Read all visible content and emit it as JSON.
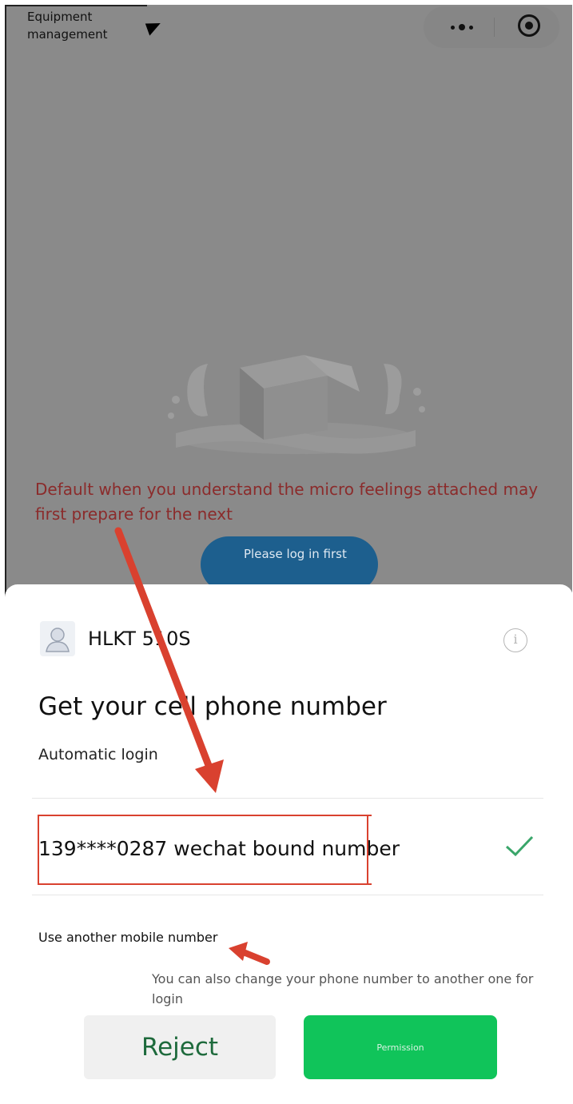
{
  "header": {
    "title": "Equipment management",
    "menu_icon": "more-dots-icon",
    "close_icon": "record-circle-icon"
  },
  "background": {
    "empty_state_icon": "open-box-icon",
    "annotation": "Default when you understand the micro feelings attached may first prepare for the next",
    "login_button": "Please log in first"
  },
  "sheet": {
    "app_name": "HLKT 510S",
    "info_icon_glyph": "i",
    "title": "Get your cell phone number",
    "subtitle": "Automatic login",
    "phone_option": "139****0287 wechat bound number",
    "other_number_link": "Use another mobile number",
    "hint": "You can also change your phone number to another one for login",
    "reject_label": "Reject",
    "permission_label": "Permission"
  },
  "colors": {
    "overlay": "#8a8a8a",
    "accent_green": "#10c45a",
    "annotation_red": "#d9412f",
    "check_green": "#3aa66a"
  }
}
